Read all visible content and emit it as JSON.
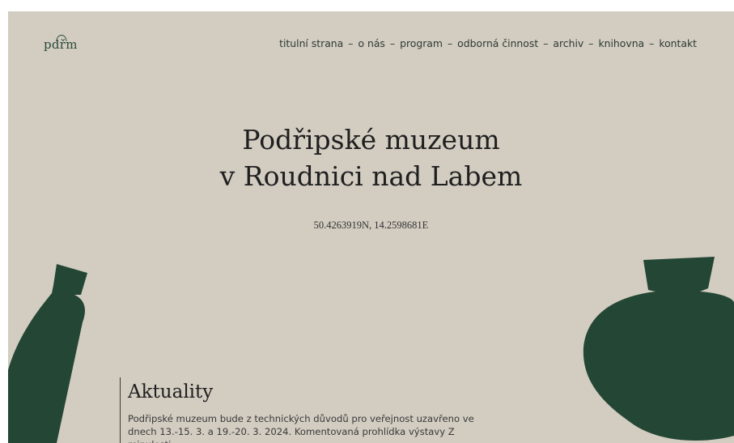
{
  "logo": {
    "text": "pdřm"
  },
  "nav": {
    "items": [
      {
        "label": "titulní strana"
      },
      {
        "label": "o nás"
      },
      {
        "label": "program"
      },
      {
        "label": "odborná činnost"
      },
      {
        "label": "archiv"
      },
      {
        "label": "knihovna"
      },
      {
        "label": "kontakt"
      }
    ],
    "separator": "–"
  },
  "hero": {
    "title_line1": "Podřipské muzeum",
    "title_line2": "v Roudnici nad Labem",
    "coordinates": "50.4263919N, 14.2598681E"
  },
  "news": {
    "heading": "Aktuality",
    "text": "Podřipské muzeum bude z technických důvodů pro veřejnost uzavřeno ve dnech 13.-15. 3. a 19.-20. 3. 2024. Komentovaná prohlídka výstavy Z minulosti"
  },
  "colors": {
    "background": "#d2ccc1",
    "accent_green": "#244634",
    "text": "#1f1f1f"
  },
  "icons": {
    "left_shape": "bottle-shape",
    "right_shape": "pot-shape"
  }
}
